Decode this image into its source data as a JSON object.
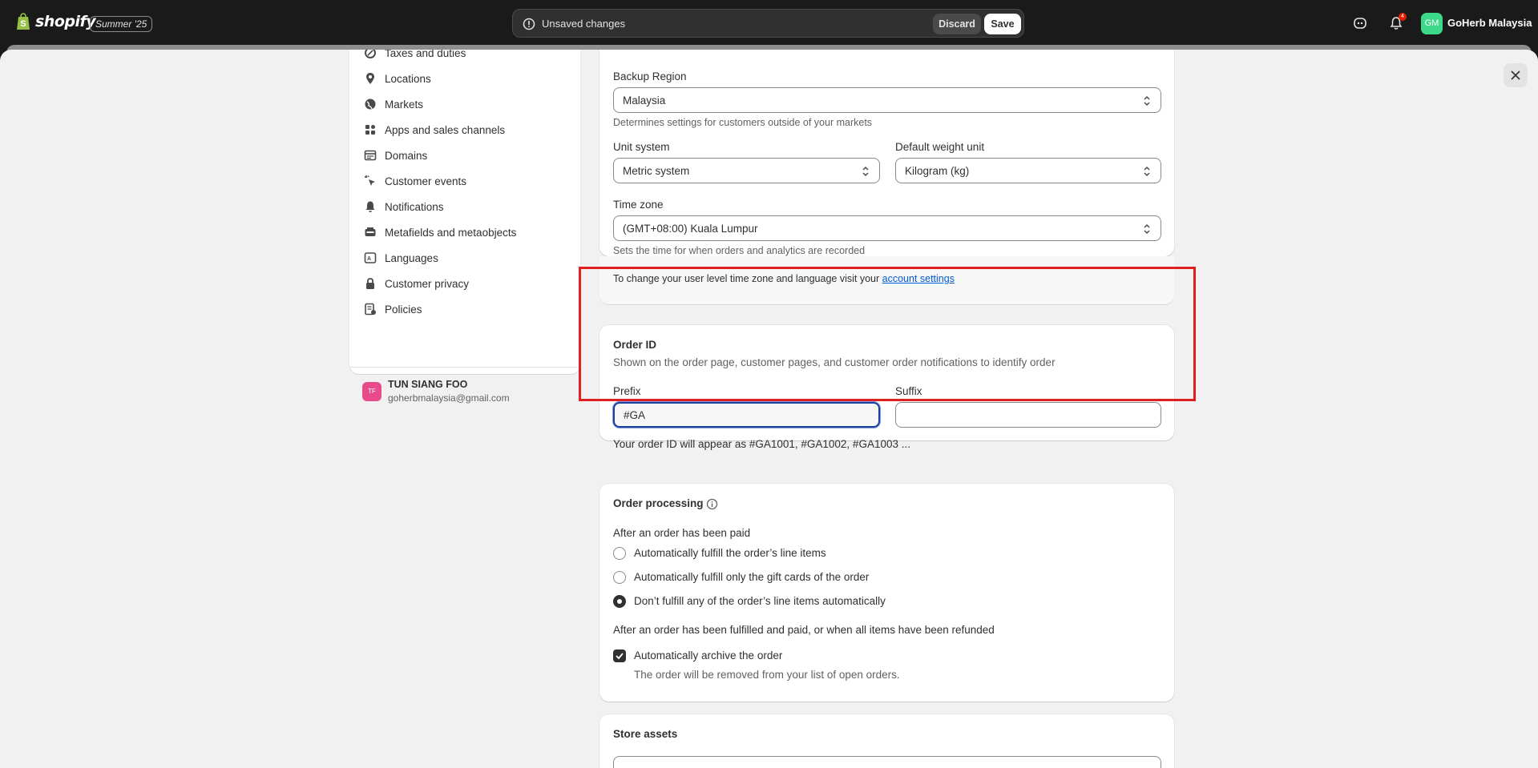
{
  "topbar": {
    "logo_text": "shopify",
    "edition_badge": "Summer '25",
    "unsaved_message": "Unsaved changes",
    "discard_label": "Discard",
    "save_label": "Save",
    "notification_count": "4",
    "store_initials": "GM",
    "store_name": "GoHerb Malaysia"
  },
  "sidebar": {
    "items": [
      {
        "label": "Taxes and duties",
        "icon": "tax-icon"
      },
      {
        "label": "Locations",
        "icon": "location-icon"
      },
      {
        "label": "Markets",
        "icon": "globe-icon"
      },
      {
        "label": "Apps and sales channels",
        "icon": "apps-icon"
      },
      {
        "label": "Domains",
        "icon": "domains-icon"
      },
      {
        "label": "Customer events",
        "icon": "cursor-icon"
      },
      {
        "label": "Notifications",
        "icon": "bell-icon"
      },
      {
        "label": "Metafields and metaobjects",
        "icon": "database-icon"
      },
      {
        "label": "Languages",
        "icon": "language-icon"
      },
      {
        "label": "Customer privacy",
        "icon": "lock-icon"
      },
      {
        "label": "Policies",
        "icon": "policy-icon"
      }
    ],
    "user": {
      "initials": "TF",
      "name": "TUN SIANG FOO",
      "email": "goherbmalaysia@gmail.com"
    }
  },
  "defaults_card": {
    "backup_region_label": "Backup Region",
    "backup_region_value": "Malaysia",
    "backup_region_help": "Determines settings for customers outside of your markets",
    "unit_system_label": "Unit system",
    "unit_system_value": "Metric system",
    "weight_unit_label": "Default weight unit",
    "weight_unit_value": "Kilogram (kg)",
    "time_zone_label": "Time zone",
    "time_zone_value": "(GMT+08:00) Kuala Lumpur",
    "time_zone_help": "Sets the time for when orders and analytics are recorded",
    "footer_text": "To change your user level time zone and language visit your ",
    "footer_link": "account settings"
  },
  "order_id_card": {
    "title": "Order ID",
    "description": "Shown on the order page, customer pages, and customer order notifications to identify order",
    "prefix_label": "Prefix",
    "prefix_value": "#GA",
    "suffix_label": "Suffix",
    "suffix_value": "",
    "preview": "Your order ID will appear as #GA1001, #GA1002, #GA1003 ..."
  },
  "order_processing_card": {
    "title": "Order processing",
    "paid_heading": "After an order has been paid",
    "options": [
      {
        "label": "Automatically fulfill the order’s line items",
        "checked": false
      },
      {
        "label": "Automatically fulfill only the gift cards of the order",
        "checked": false
      },
      {
        "label": "Don’t fulfill any of the order’s line items automatically",
        "checked": true
      }
    ],
    "fulfilled_heading": "After an order has been fulfilled and paid, or when all items have been refunded",
    "archive_label": "Automatically archive the order",
    "archive_checked": true,
    "archive_help": "The order will be removed from your list of open orders."
  },
  "store_assets_card": {
    "title": "Store assets"
  },
  "colors": {
    "accent": "#005bd3",
    "highlight": "#e02020",
    "focus": "#1f3f9c"
  }
}
